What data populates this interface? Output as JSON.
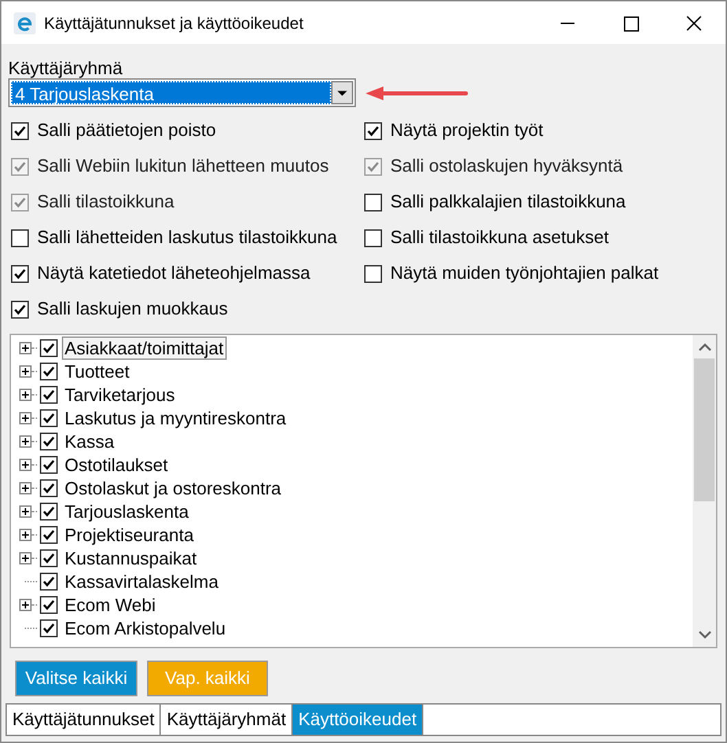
{
  "window": {
    "title": "Käyttäjätunnukset ja käyttöoikeudet"
  },
  "group": {
    "label": "Käyttäjäryhmä",
    "value": "4 Tarjouslaskenta"
  },
  "options": [
    {
      "label": "Salli päätietojen poisto",
      "checked": true,
      "disabled": false
    },
    {
      "label": "Näytä projektin työt",
      "checked": true,
      "disabled": false
    },
    {
      "label": "Salli Webiin lukitun lähetteen muutos",
      "checked": true,
      "disabled": true
    },
    {
      "label": "Salli ostolaskujen hyväksyntä",
      "checked": true,
      "disabled": true
    },
    {
      "label": "Salli tilastoikkuna",
      "checked": true,
      "disabled": true
    },
    {
      "label": "Salli palkkalajien tilastoikkuna",
      "checked": false,
      "disabled": false
    },
    {
      "label": "Salli lähetteiden laskutus tilastoikkuna",
      "checked": false,
      "disabled": false
    },
    {
      "label": "Salli tilastoikkuna asetukset",
      "checked": false,
      "disabled": false
    },
    {
      "label": "Näytä katetiedot läheteohjelmassa",
      "checked": true,
      "disabled": false
    },
    {
      "label": "Näytä muiden työnjohtajien palkat",
      "checked": false,
      "disabled": false
    },
    {
      "label": "Salli laskujen muokkaus",
      "checked": true,
      "disabled": false
    }
  ],
  "tree": [
    {
      "label": "Asiakkaat/toimittajat",
      "checked": true,
      "expandable": true,
      "selected": true
    },
    {
      "label": "Tuotteet",
      "checked": true,
      "expandable": true,
      "selected": false
    },
    {
      "label": "Tarviketarjous",
      "checked": true,
      "expandable": true,
      "selected": false
    },
    {
      "label": "Laskutus ja myyntireskontra",
      "checked": true,
      "expandable": true,
      "selected": false
    },
    {
      "label": "Kassa",
      "checked": true,
      "expandable": true,
      "selected": false
    },
    {
      "label": "Ostotilaukset",
      "checked": true,
      "expandable": true,
      "selected": false
    },
    {
      "label": "Ostolaskut ja ostoreskontra",
      "checked": true,
      "expandable": true,
      "selected": false
    },
    {
      "label": "Tarjouslaskenta",
      "checked": true,
      "expandable": true,
      "selected": false
    },
    {
      "label": "Projektiseuranta",
      "checked": true,
      "expandable": true,
      "selected": false
    },
    {
      "label": "Kustannuspaikat",
      "checked": true,
      "expandable": true,
      "selected": false
    },
    {
      "label": "Kassavirtalaskelma",
      "checked": true,
      "expandable": false,
      "selected": false
    },
    {
      "label": "Ecom Webi",
      "checked": true,
      "expandable": true,
      "selected": false
    },
    {
      "label": "Ecom Arkistopalvelu",
      "checked": true,
      "expandable": false,
      "selected": false
    }
  ],
  "buttons": [
    {
      "label": "Valitse kaikki",
      "kind": "primary"
    },
    {
      "label": "Vap. kaikki",
      "kind": "secondary"
    }
  ],
  "tabs": [
    {
      "label": "Käyttäjätunnukset",
      "selected": false
    },
    {
      "label": "Käyttäjäryhmät",
      "selected": false
    },
    {
      "label": "Käyttöoikeudet",
      "selected": true
    }
  ]
}
